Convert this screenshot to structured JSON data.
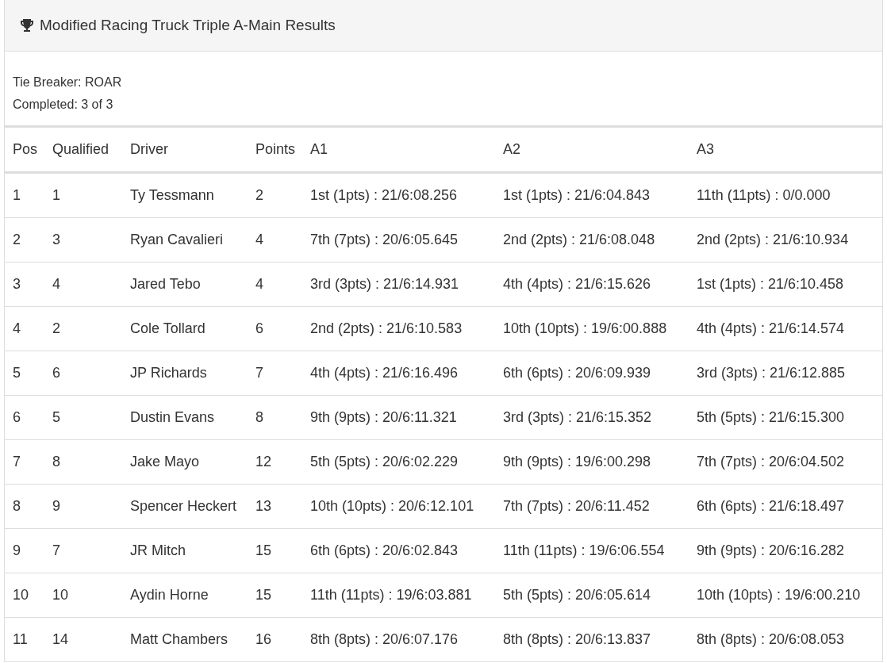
{
  "panel": {
    "title": "Modified Racing Truck Triple A-Main Results"
  },
  "info": [
    "Tie Breaker: ROAR",
    "Completed: 3 of 3"
  ],
  "table": {
    "columns": [
      "Pos",
      "Qualified",
      "Driver",
      "Points",
      "A1",
      "A2",
      "A3"
    ],
    "rows": [
      [
        "1",
        "1",
        "Ty Tessmann",
        "2",
        "1st (1pts) : 21/6:08.256",
        "1st (1pts) : 21/6:04.843",
        "11th (11pts) : 0/0.000"
      ],
      [
        "2",
        "3",
        "Ryan Cavalieri",
        "4",
        "7th (7pts) : 20/6:05.645",
        "2nd (2pts) : 21/6:08.048",
        "2nd (2pts) : 21/6:10.934"
      ],
      [
        "3",
        "4",
        "Jared Tebo",
        "4",
        "3rd (3pts) : 21/6:14.931",
        "4th (4pts) : 21/6:15.626",
        "1st (1pts) : 21/6:10.458"
      ],
      [
        "4",
        "2",
        "Cole Tollard",
        "6",
        "2nd (2pts) : 21/6:10.583",
        "10th (10pts) : 19/6:00.888",
        "4th (4pts) : 21/6:14.574"
      ],
      [
        "5",
        "6",
        "JP Richards",
        "7",
        "4th (4pts) : 21/6:16.496",
        "6th (6pts) : 20/6:09.939",
        "3rd (3pts) : 21/6:12.885"
      ],
      [
        "6",
        "5",
        "Dustin Evans",
        "8",
        "9th (9pts) : 20/6:11.321",
        "3rd (3pts) : 21/6:15.352",
        "5th (5pts) : 21/6:15.300"
      ],
      [
        "7",
        "8",
        "Jake Mayo",
        "12",
        "5th (5pts) : 20/6:02.229",
        "9th (9pts) : 19/6:00.298",
        "7th (7pts) : 20/6:04.502"
      ],
      [
        "8",
        "9",
        "Spencer Heckert",
        "13",
        "10th (10pts) : 20/6:12.101",
        "7th (7pts) : 20/6:11.452",
        "6th (6pts) : 21/6:18.497"
      ],
      [
        "9",
        "7",
        "JR Mitch",
        "15",
        "6th (6pts) : 20/6:02.843",
        "11th (11pts) : 19/6:06.554",
        "9th (9pts) : 20/6:16.282"
      ],
      [
        "10",
        "10",
        "Aydin Horne",
        "15",
        "11th (11pts) : 19/6:03.881",
        "5th (5pts) : 20/6:05.614",
        "10th (10pts) : 19/6:00.210"
      ],
      [
        "11",
        "14",
        "Matt Chambers",
        "16",
        "8th (8pts) : 20/6:07.176",
        "8th (8pts) : 20/6:13.837",
        "8th (8pts) : 20/6:08.053"
      ]
    ]
  }
}
